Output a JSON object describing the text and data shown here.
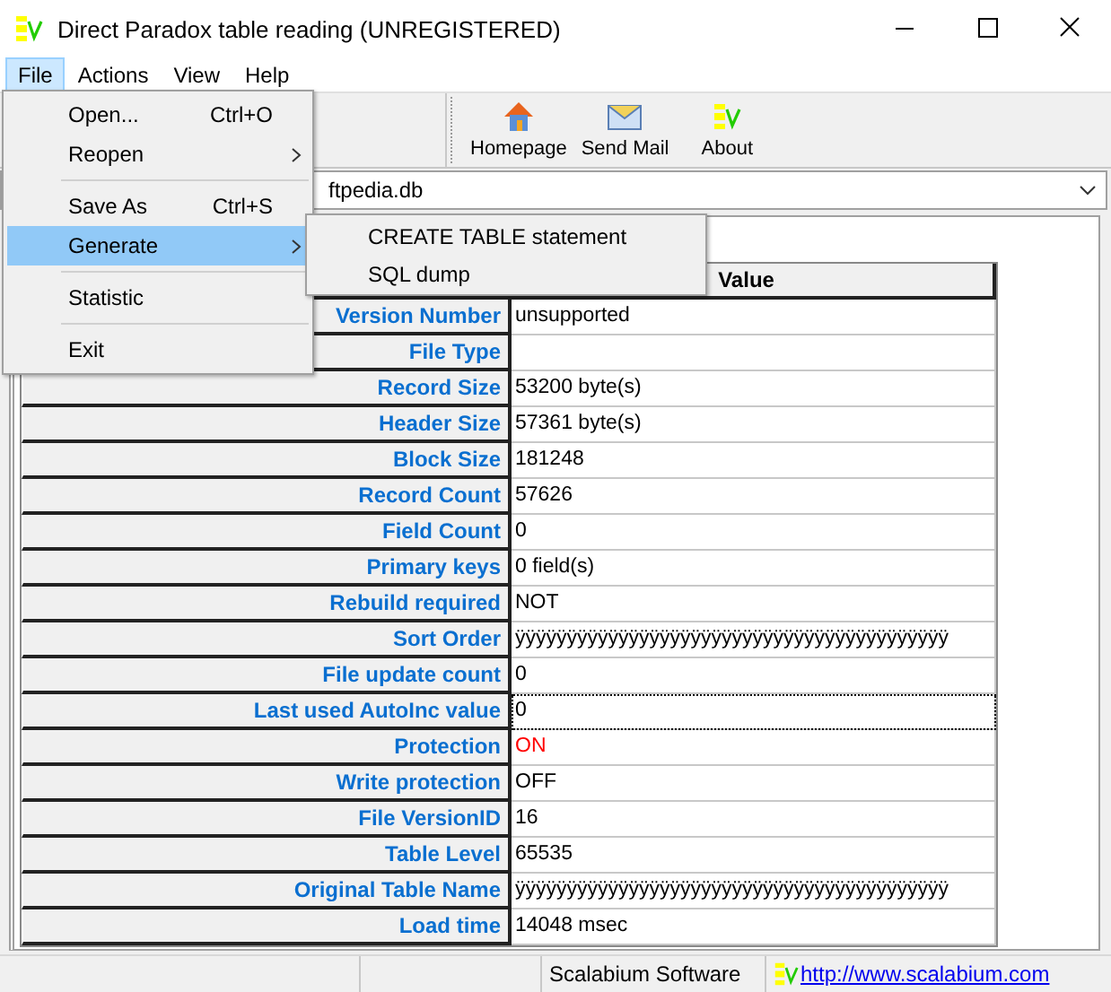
{
  "window": {
    "title": "Direct Paradox table reading (UNREGISTERED)"
  },
  "menu_bar": [
    {
      "label": "File",
      "selected": true
    },
    {
      "label": "Actions",
      "selected": false
    },
    {
      "label": "View",
      "selected": false
    },
    {
      "label": "Help",
      "selected": false
    }
  ],
  "file_menu": [
    {
      "kind": "item",
      "label": "Open...",
      "shortcut": "Ctrl+O",
      "submenu": false,
      "selected": false
    },
    {
      "kind": "item",
      "label": "Reopen",
      "submenu": true,
      "selected": false
    },
    {
      "kind": "separator"
    },
    {
      "kind": "item",
      "label": "Save As",
      "shortcut": "Ctrl+S",
      "submenu": false,
      "selected": false
    },
    {
      "kind": "item",
      "label": "Generate",
      "submenu": true,
      "selected": true
    },
    {
      "kind": "separator"
    },
    {
      "kind": "item",
      "label": "Statistic",
      "submenu": false,
      "selected": false
    },
    {
      "kind": "separator"
    },
    {
      "kind": "item",
      "label": "Exit",
      "submenu": false,
      "selected": false
    }
  ],
  "generate_submenu": [
    {
      "label": "CREATE TABLE statement"
    },
    {
      "label": "SQL dump"
    }
  ],
  "toolbar": [
    {
      "kind": "home",
      "label": "Homepage"
    },
    {
      "kind": "mail",
      "label": "Send Mail"
    },
    {
      "kind": "logo",
      "label": "About"
    }
  ],
  "file_combo": {
    "value": "ftpedia.db"
  },
  "table": {
    "value_header": "Value",
    "rows": [
      {
        "name": "Version Number",
        "value": "unsupported",
        "alert": false,
        "focused": false
      },
      {
        "name": "File Type",
        "value": "",
        "focused": false
      },
      {
        "name": "Record Size",
        "value": "53200 byte(s)",
        "alert": false,
        "focused": false
      },
      {
        "name": "Header Size",
        "value": "57361 byte(s)",
        "alert": false,
        "focused": false
      },
      {
        "name": "Block Size",
        "value": "181248",
        "alert": false,
        "focused": false
      },
      {
        "name": "Record Count",
        "value": "57626",
        "alert": false,
        "focused": false
      },
      {
        "name": "Field Count",
        "value": "0",
        "alert": false,
        "focused": false
      },
      {
        "name": "Primary keys",
        "value": "0 field(s)",
        "alert": false,
        "focused": false
      },
      {
        "name": "Rebuild required",
        "value": "NOT",
        "alert": false,
        "focused": false
      },
      {
        "name": "Sort Order",
        "value": "ÿÿÿÿÿÿÿÿÿÿÿÿÿÿÿÿÿÿÿÿÿÿÿÿÿÿÿÿÿÿÿÿÿÿÿÿÿÿÿÿÿÿ",
        "alert": false,
        "focused": false
      },
      {
        "name": "File update count",
        "value": "0",
        "alert": false,
        "focused": false
      },
      {
        "name": "Last used AutoInc value",
        "value": "0",
        "alert": false,
        "focused": true
      },
      {
        "name": "Protection",
        "value": "ON",
        "alert": true,
        "focused": false
      },
      {
        "name": "Write protection",
        "value": "OFF",
        "alert": false,
        "focused": false
      },
      {
        "name": "File VersionID",
        "value": "16",
        "alert": false,
        "focused": false
      },
      {
        "name": "Table Level",
        "value": "65535",
        "alert": false,
        "focused": false
      },
      {
        "name": "Original Table Name",
        "value": "ÿÿÿÿÿÿÿÿÿÿÿÿÿÿÿÿÿÿÿÿÿÿÿÿÿÿÿÿÿÿÿÿÿÿÿÿÿÿÿÿÿÿ",
        "alert": false,
        "focused": false
      },
      {
        "name": "Load time",
        "value": "14048 msec",
        "alert": false,
        "focused": false
      }
    ]
  },
  "status_bar": {
    "company": "Scalabium Software",
    "link": "http://www.scalabium.com"
  }
}
